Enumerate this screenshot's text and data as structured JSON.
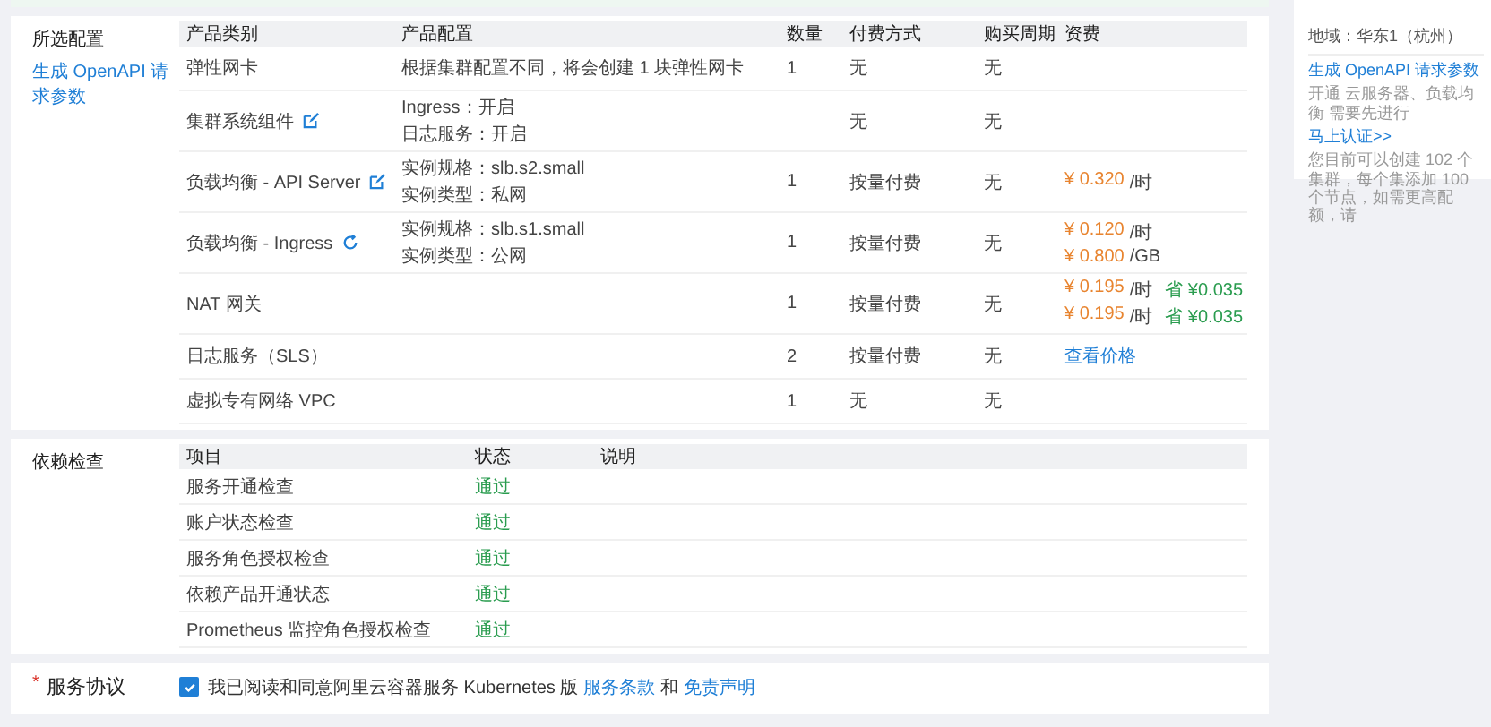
{
  "config": {
    "title": "所选配置",
    "openapi_link": "生成 OpenAPI 请求参数",
    "columns": [
      "产品类别",
      "产品配置",
      "数量",
      "付费方式",
      "购买周期",
      "资费"
    ],
    "rows": [
      {
        "category": "弹性网卡",
        "kind": "plain",
        "config": [
          "根据集群配置不同，将会创建 1 块弹性网卡"
        ],
        "qty": "1",
        "billing": "无",
        "period": "无",
        "cost": []
      },
      {
        "category": "集群系统组件",
        "kind": "editable",
        "config": [
          "Ingress：开启",
          "日志服务：开启"
        ],
        "qty": "",
        "billing": "无",
        "period": "无",
        "cost": []
      },
      {
        "category": "负载均衡 - API Server",
        "kind": "editable",
        "config": [
          "实例规格：slb.s2.small",
          "实例类型：私网"
        ],
        "qty": "1",
        "billing": "按量付费",
        "period": "无",
        "cost": [
          {
            "kind": "price",
            "amount": "¥ 0.320",
            "unit": "/时"
          }
        ]
      },
      {
        "category": "负载均衡 - Ingress",
        "kind": "refreshable",
        "config": [
          "实例规格：slb.s1.small",
          "实例类型：公网"
        ],
        "qty": "1",
        "billing": "按量付费",
        "period": "无",
        "cost": [
          {
            "kind": "price",
            "amount": "¥ 0.120",
            "unit": "/时"
          },
          {
            "kind": "price",
            "amount": "¥ 0.800",
            "unit": "/GB"
          }
        ]
      },
      {
        "category": "NAT 网关",
        "kind": "plain",
        "config": [],
        "qty": "1",
        "billing": "按量付费",
        "period": "无",
        "cost": [
          {
            "kind": "price",
            "amount": "¥ 0.195",
            "unit": "/时",
            "saving": "省 ¥0.035"
          },
          {
            "kind": "price",
            "amount": "¥ 0.195",
            "unit": "/时",
            "saving": "省 ¥0.035"
          }
        ]
      },
      {
        "category": "日志服务（SLS）",
        "kind": "plain",
        "config": [],
        "qty": "2",
        "billing": "按量付费",
        "period": "无",
        "cost": [
          {
            "kind": "link",
            "text": "查看价格"
          }
        ]
      },
      {
        "category": "虚拟专有网络 VPC",
        "kind": "plain",
        "config": [],
        "qty": "1",
        "billing": "无",
        "period": "无",
        "cost": []
      }
    ]
  },
  "checks": {
    "title": "依赖检查",
    "columns": [
      "项目",
      "状态",
      "说明"
    ],
    "rows": [
      {
        "item": "服务开通检查",
        "status": "通过",
        "kind": "pass"
      },
      {
        "item": "账户状态检查",
        "status": "通过",
        "kind": "pass"
      },
      {
        "item": "服务角色授权检查",
        "status": "通过",
        "kind": "pass"
      },
      {
        "item": "依赖产品开通状态",
        "status": "通过",
        "kind": "pass"
      },
      {
        "item": "Prometheus 监控角色授权检查",
        "status": "通过",
        "kind": "pass"
      }
    ]
  },
  "agreement": {
    "required_mark": "*",
    "title": "服务协议",
    "checked": true,
    "text": "我已阅读和同意阿里云容器服务 Kubernetes 版",
    "link_1": "服务条款",
    "joiner": "和",
    "link_2": "免责声明"
  },
  "side": {
    "region": "地域：华东1（杭州）",
    "openapi_link": "生成 OpenAPI 请求参数",
    "notice": "开通 云服务器、负载均衡 需要先进行",
    "verify_link": "马上认证>>",
    "quota": "您目前可以创建 102 个集群，每个集添加 100 个节点，如需更高配额，请"
  }
}
